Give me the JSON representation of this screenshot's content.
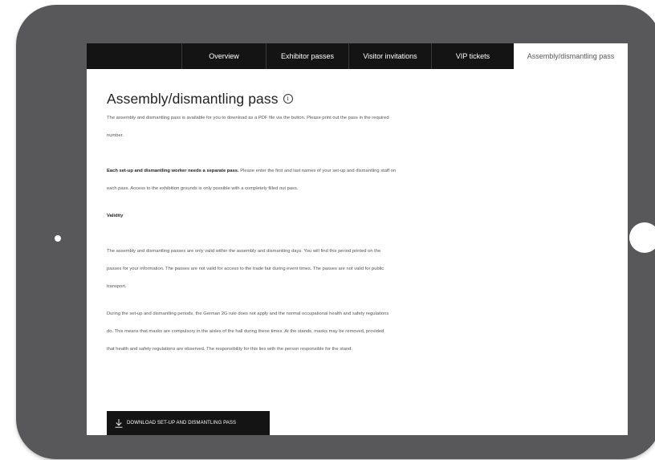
{
  "tabs": [
    {
      "label": "Overview",
      "active": false
    },
    {
      "label": "Exhibitor passes",
      "active": false
    },
    {
      "label": "Visitor invitations",
      "active": false
    },
    {
      "label": "VIP tickets",
      "active": false
    },
    {
      "label": "Assembly/dismantling pass",
      "active": true
    }
  ],
  "page": {
    "title": "Assembly/dismantling pass",
    "info_icon": "i",
    "intro_line1": "The assembly and dismantling pass is available for you to download as a PDF file via the button. Please print out the pass in the required",
    "intro_line2": "number.",
    "worker_bold": "Each set-up and dismantling worker needs a separate pass.",
    "worker_text1": " Please enter the first and last names of your set-up and dismantling staff on",
    "worker_text2": "each pass. Access to the exhibition grounds is only possible with a completely filled out pass.",
    "validity_heading": "Validity",
    "validity_line1": "The assembly and dismantling passes are only valid within the assembly and dismantling days. You will find this period printed on the",
    "validity_line2": "passes for your information. The passes are not valid for access to the trade fair during event times. The passes are not valid for public",
    "validity_line3": "transport.",
    "rules_line1": "During the set-up and dismantling periods, the German 2G rule does not apply and the normal occupational health and safety regulations",
    "rules_line2": "do. This means that masks are compulsory in the aisles of the hall during these times. At the stands, masks may be removed, provided",
    "rules_line3": "that health and safety regulations are observed. The responsibility for this lies with the person responsible for the stand."
  },
  "download_button": {
    "label": "DOWNLOAD SET-UP AND DISMANTLING PASS",
    "icon": "download-icon"
  },
  "colors": {
    "frame": "#58585a",
    "tabbar": "#141414",
    "button": "#141414",
    "text": "#555555"
  }
}
